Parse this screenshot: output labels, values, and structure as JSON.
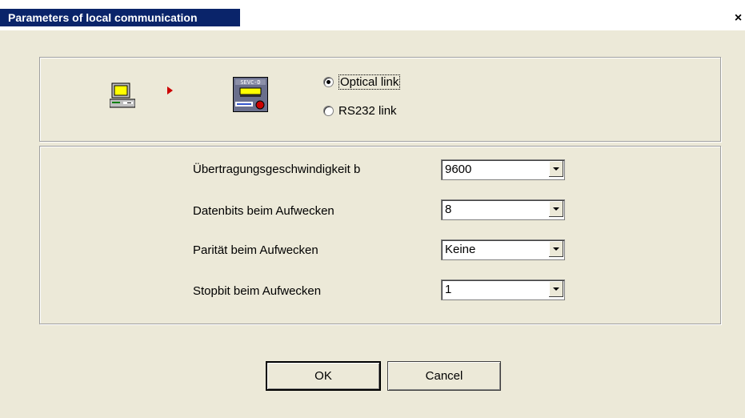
{
  "window": {
    "title": "Parameters of local communication",
    "close_glyph": "×"
  },
  "link": {
    "pc_icon": "computer-icon",
    "arrow_icon": "arrow-right-icon",
    "device_icon": "sevc-device-icon",
    "device_label": "SEVC-D",
    "options": [
      {
        "label": "Optical link",
        "selected": true
      },
      {
        "label": "RS232 link",
        "selected": false
      }
    ]
  },
  "params": [
    {
      "label": "Übertragungsgeschwindigkeit b",
      "value": "9600"
    },
    {
      "label": "Datenbits beim Aufwecken",
      "value": "8"
    },
    {
      "label": "Parität beim Aufwecken",
      "value": "Keine"
    },
    {
      "label": "Stopbit beim Aufwecken",
      "value": "1"
    }
  ],
  "buttons": {
    "ok": "OK",
    "cancel": "Cancel"
  },
  "colors": {
    "title_bar": "#0a246a",
    "dialog_bg": "#ece9d8",
    "arrow": "#cc0000"
  }
}
